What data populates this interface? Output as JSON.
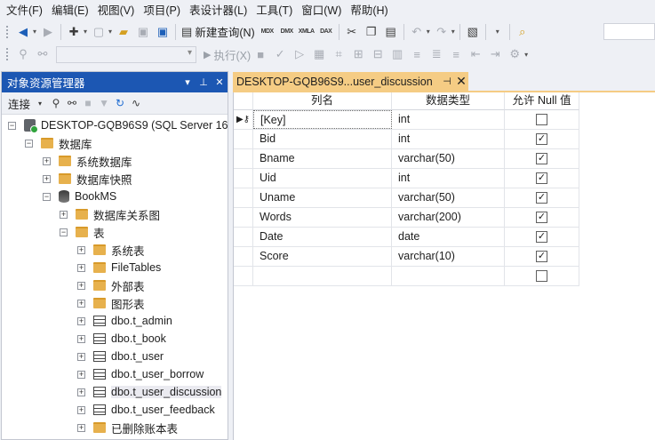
{
  "menu": [
    "文件(F)",
    "编辑(E)",
    "视图(V)",
    "项目(P)",
    "表设计器(L)",
    "工具(T)",
    "窗口(W)",
    "帮助(H)"
  ],
  "toolbar": {
    "new_query_label": "新建查询(N)",
    "execute_label": "执行(X)",
    "icon_labels": {
      "mdx": "MDX",
      "dmx": "DMX",
      "xmla": "XMLA",
      "dax": "DAX"
    }
  },
  "object_explorer": {
    "title": "对象资源管理器",
    "connect_label": "连接",
    "tree": [
      {
        "level": 0,
        "label": "DESKTOP-GQB96S9 (SQL Server 16",
        "icon": "server",
        "expander": "−"
      },
      {
        "level": 1,
        "label": "数据库",
        "icon": "folder",
        "expander": "−"
      },
      {
        "level": 2,
        "label": "系统数据库",
        "icon": "folder",
        "expander": "+"
      },
      {
        "level": 2,
        "label": "数据库快照",
        "icon": "folder",
        "expander": "+"
      },
      {
        "level": 2,
        "label": "BookMS",
        "icon": "database",
        "expander": "−"
      },
      {
        "level": 3,
        "label": "数据库关系图",
        "icon": "folder",
        "expander": "+"
      },
      {
        "level": 3,
        "label": "表",
        "icon": "folder",
        "expander": "−"
      },
      {
        "level": 4,
        "label": "系统表",
        "icon": "folder",
        "expander": "+"
      },
      {
        "level": 4,
        "label": "FileTables",
        "icon": "folder",
        "expander": "+"
      },
      {
        "level": 4,
        "label": "外部表",
        "icon": "folder",
        "expander": "+"
      },
      {
        "level": 4,
        "label": "图形表",
        "icon": "folder",
        "expander": "+"
      },
      {
        "level": 4,
        "label": "dbo.t_admin",
        "icon": "table",
        "expander": "+"
      },
      {
        "level": 4,
        "label": "dbo.t_book",
        "icon": "table",
        "expander": "+"
      },
      {
        "level": 4,
        "label": "dbo.t_user",
        "icon": "table",
        "expander": "+"
      },
      {
        "level": 4,
        "label": "dbo.t_user_borrow",
        "icon": "table",
        "expander": "+"
      },
      {
        "level": 4,
        "label": "dbo.t_user_discussion",
        "icon": "table",
        "expander": "+",
        "selected": true
      },
      {
        "level": 4,
        "label": "dbo.t_user_feedback",
        "icon": "table",
        "expander": "+"
      },
      {
        "level": 4,
        "label": "已删除账本表",
        "icon": "folder",
        "expander": "+"
      }
    ]
  },
  "document_tab": {
    "title": "DESKTOP-GQB96S9...user_discussion",
    "pin": "⊣",
    "close": "✕"
  },
  "designer": {
    "headers": {
      "column_name": "列名",
      "data_type": "数据类型",
      "allow_null": "允许 Null 值"
    },
    "rows": [
      {
        "name": "[Key]",
        "type": "int",
        "allow_null": false,
        "primary_key": true,
        "focused": true
      },
      {
        "name": "Bid",
        "type": "int",
        "allow_null": true
      },
      {
        "name": "Bname",
        "type": "varchar(50)",
        "allow_null": true
      },
      {
        "name": "Uid",
        "type": "int",
        "allow_null": true
      },
      {
        "name": "Uname",
        "type": "varchar(50)",
        "allow_null": true
      },
      {
        "name": "Words",
        "type": "varchar(200)",
        "allow_null": true
      },
      {
        "name": "Date",
        "type": "date",
        "allow_null": true
      },
      {
        "name": "Score",
        "type": "varchar(10)",
        "allow_null": true
      },
      {
        "name": "",
        "type": "",
        "allow_null": false
      }
    ]
  }
}
